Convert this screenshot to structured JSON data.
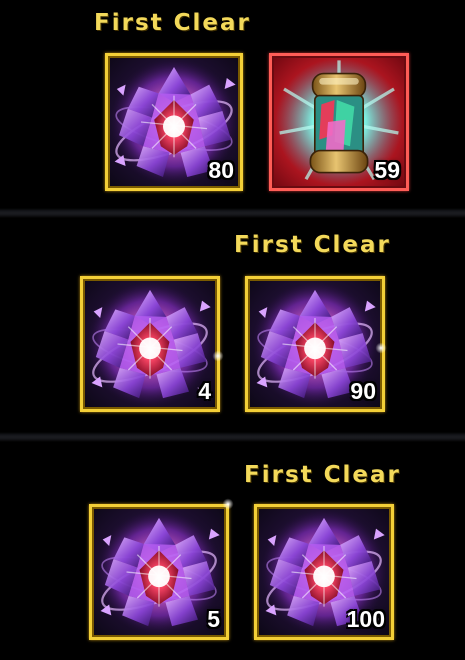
{
  "sections": [
    {
      "title": "First Clear",
      "rewards": [
        {
          "icon": "crystal-icon",
          "count": "80",
          "frame": "gold"
        },
        {
          "icon": "crystal-capsule-icon",
          "count": "59",
          "frame": "red"
        }
      ]
    },
    {
      "title": "First Clear",
      "rewards": [
        {
          "icon": "crystal-icon",
          "count": "4",
          "frame": "gold"
        },
        {
          "icon": "crystal-icon",
          "count": "90",
          "frame": "gold"
        }
      ]
    },
    {
      "title": "First Clear",
      "rewards": [
        {
          "icon": "crystal-icon",
          "count": "5",
          "frame": "gold"
        },
        {
          "icon": "crystal-icon",
          "count": "100",
          "frame": "gold"
        }
      ]
    }
  ],
  "colors": {
    "title": "#f3d95a",
    "gold_frame": "#f3cf37",
    "red_frame": "#ff5d57",
    "background": "#000000"
  }
}
